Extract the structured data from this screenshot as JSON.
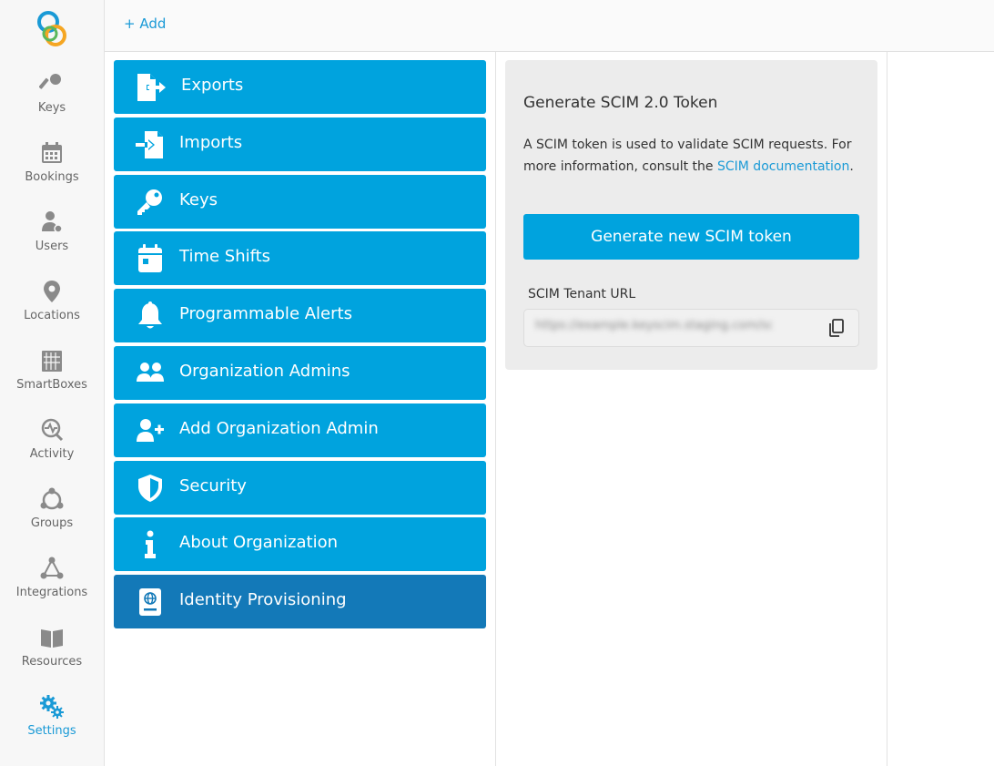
{
  "topbar": {
    "add_label": "+ Add"
  },
  "nav": {
    "items": [
      {
        "label": "Keys",
        "icon": "key-icon"
      },
      {
        "label": "Bookings",
        "icon": "calendar-icon"
      },
      {
        "label": "Users",
        "icon": "user-icon"
      },
      {
        "label": "Locations",
        "icon": "location-pin-icon"
      },
      {
        "label": "SmartBoxes",
        "icon": "smartbox-icon"
      },
      {
        "label": "Activity",
        "icon": "activity-icon"
      },
      {
        "label": "Groups",
        "icon": "groups-icon"
      },
      {
        "label": "Integrations",
        "icon": "integrations-icon"
      },
      {
        "label": "Resources",
        "icon": "book-icon"
      },
      {
        "label": "Settings",
        "icon": "gears-icon"
      }
    ],
    "active": "Settings"
  },
  "menu": {
    "items": [
      {
        "label": "Exports",
        "icon": "export-icon"
      },
      {
        "label": "Imports",
        "icon": "import-icon"
      },
      {
        "label": "Keys",
        "icon": "key-icon"
      },
      {
        "label": "Time Shifts",
        "icon": "calendar-icon"
      },
      {
        "label": "Programmable Alerts",
        "icon": "bell-icon"
      },
      {
        "label": "Organization Admins",
        "icon": "users-icon"
      },
      {
        "label": "Add Organization Admin",
        "icon": "user-plus-icon"
      },
      {
        "label": "Security",
        "icon": "shield-icon"
      },
      {
        "label": "About Organization",
        "icon": "info-icon"
      },
      {
        "label": "Identity Provisioning",
        "icon": "id-card-icon"
      }
    ],
    "active": "Identity Provisioning"
  },
  "panel": {
    "title": "Generate SCIM 2.0 Token",
    "desc_prefix": "A SCIM token is used to validate SCIM requests. For more information, consult the ",
    "desc_link": "SCIM documentation",
    "desc_suffix": ".",
    "generate_label": "Generate new SCIM token",
    "url_label": "SCIM Tenant URL",
    "url_value": "https://example.keyscim.staging.com/scim/##########"
  },
  "colors": {
    "accent": "#00a3de",
    "active": "#1379b8",
    "link": "#1a9ad6"
  }
}
